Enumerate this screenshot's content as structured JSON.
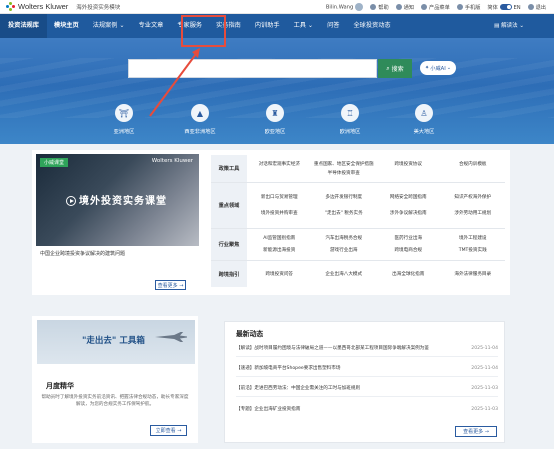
{
  "topbar": {
    "logo": "Wolters Kluwer",
    "module": "海外投资实务模块",
    "user": "Bilin.Wang",
    "help": "帮助",
    "notice": "通知",
    "products": "产品菜单",
    "mobile": "手机版",
    "lang_zh": "简体",
    "lang_en": "EN",
    "logout": "退出"
  },
  "nav": {
    "items": [
      "投资法规库",
      "模块主页",
      "法规案例 ⌄",
      "专业文章",
      "专家服务",
      "实务指南",
      "内训助手",
      "工具 ⌄",
      "问答",
      "全球投资动态"
    ],
    "right": "解读法"
  },
  "hero": {
    "search_button": "搜索",
    "ai_button": "小威AI",
    "regions": [
      "亚洲地区",
      "西亚非洲地区",
      "欧亚地区",
      "欧洲地区",
      "美大地区"
    ]
  },
  "course": {
    "tag": "小威课堂",
    "logo": "Wolters Kluwer",
    "title": "境外投资实务课堂",
    "caption": "中国企业跨境投资争议解决的建筑问题",
    "more": "查看更多 →"
  },
  "grid": [
    {
      "cat": "政策工具",
      "cells": [
        "对话和宏观事实经济",
        "重点国家、地区安全保护措施",
        "跨境投资协议",
        "合规内训模板",
        "",
        "半导体投资审查",
        "",
        ""
      ]
    },
    {
      "cat": "重点领域",
      "cells": [
        "新出口与贸易管理",
        "多边开发银行制度",
        "网络安全跨国指南",
        "知识产权海外保护",
        "境外投资并购审查",
        "\"走出去\" 税务实务",
        "涉外争议解决指南",
        "涉外劳动用工规划"
      ]
    },
    {
      "cat": "行业聚焦",
      "cells": [
        "AI监管国别指南",
        "汽车出海税务合规",
        "医药行业出海",
        "境外工程建设",
        "新能源出海投资",
        "游戏行业出海",
        "跨境电商合规",
        "TMT投资实践"
      ]
    },
    {
      "cat": "跨境指引",
      "cells": [
        "跨境投资问答",
        "企业出海八大模式",
        "出海全球化指南",
        "海外法律服务目录"
      ]
    }
  ],
  "bottom": {
    "toolbox": "\"走出去\" 工具箱",
    "monthly_title": "月度精华",
    "monthly_desc": "帮助员时了解境外投资实务前沿资讯、把握法律合规动态，助长专家深度解读，为您的合规实务工作保驾护航。",
    "monthly_more": "立即查看 →",
    "news_title": "最新动态",
    "news": [
      {
        "text": "【解读】战时项目履约困境与法律破局之道——以墨西哥北部某工程项目国际争端解决案例为鉴",
        "date": "2025-11-04"
      },
      {
        "text": "【速递】新加坡电商平台Shopee要求出售塑料市场",
        "date": "2025-11-04"
      },
      {
        "text": "【前沿】走进巴西劳动法：中国企业需关注的工时与加班规则",
        "date": "2025-11-03"
      },
      {
        "text": "【专题】企业出海矿业投资指南",
        "date": "2025-11-03"
      }
    ],
    "news_more": "查看更多 →"
  },
  "colors": {
    "nav": "#1f5a9e",
    "search_button": "#2f8b5a",
    "highlight": "#e74c3c"
  }
}
